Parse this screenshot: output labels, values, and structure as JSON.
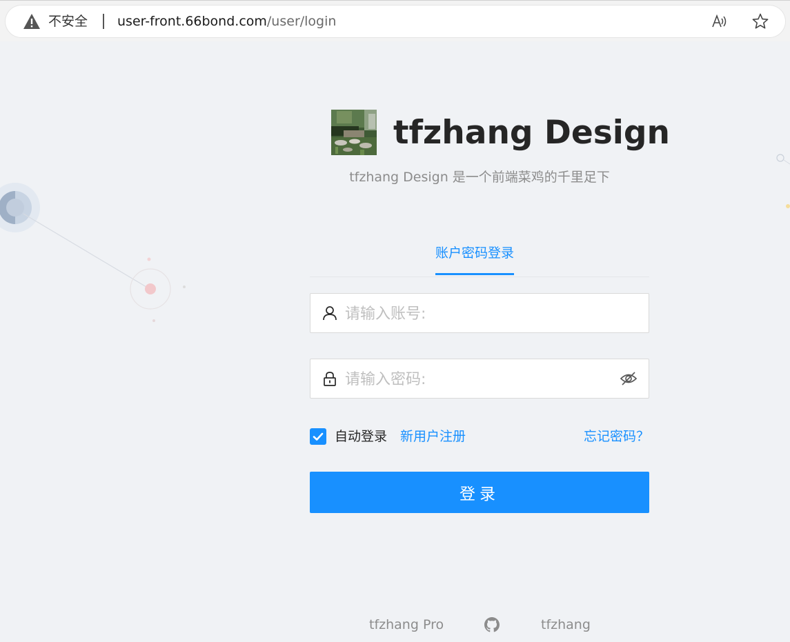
{
  "browser": {
    "security_label": "不安全",
    "url_host": "user-front.66bond.com",
    "url_path": "/user/login"
  },
  "header": {
    "title": "tfzhang Design",
    "description": "tfzhang Design 是一个前端菜鸡的千里足下"
  },
  "tabs": [
    {
      "label": "账户密码登录",
      "active": true
    }
  ],
  "form": {
    "account_placeholder": "请输入账号:",
    "password_placeholder": "请输入密码:",
    "auto_login_label": "自动登录",
    "auto_login_checked": true,
    "register_link": "新用户注册",
    "forgot_link": "忘记密码？",
    "submit_label": "登录"
  },
  "footer": {
    "links": [
      "tfzhang Pro",
      "tfzhang"
    ]
  },
  "colors": {
    "primary": "#1890ff",
    "background": "#f0f2f5"
  }
}
